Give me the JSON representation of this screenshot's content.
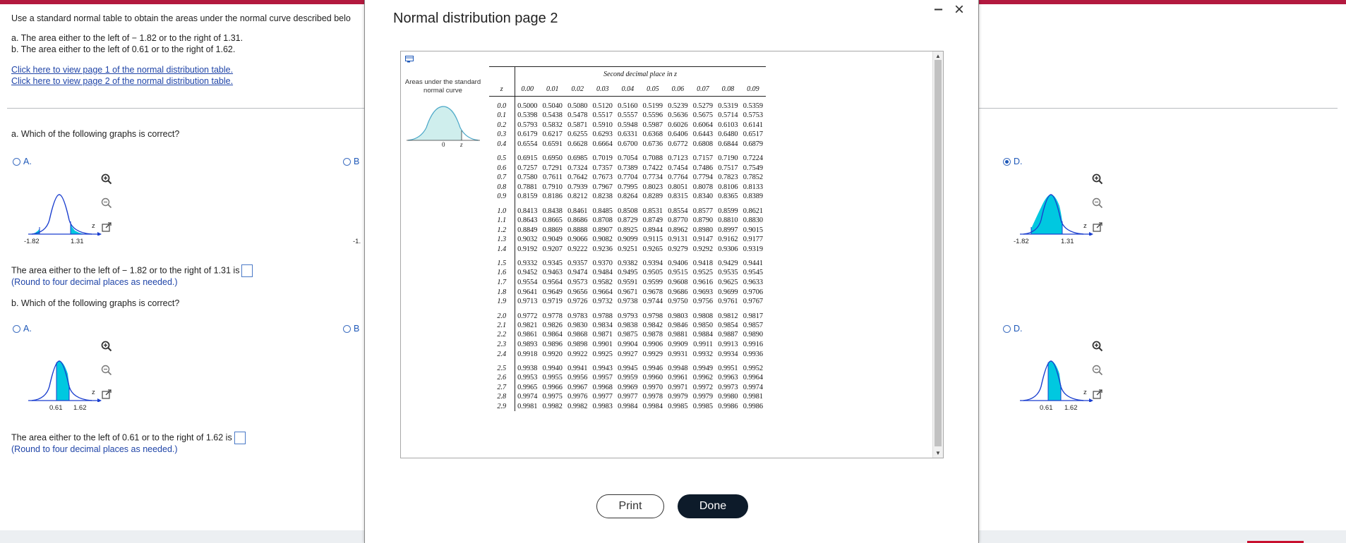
{
  "question": {
    "instruction": "Use a standard normal table to obtain the areas under the normal curve described belo",
    "part_a_text": "a. The area either to the left of  − 1.82 or to the right of 1.31.",
    "part_b_text": "b. The area either to the left of 0.61 or to the right of 1.62.",
    "link1": "Click here to view page 1 of the normal distribution table.",
    "link2": "Click here to view page 2 of the normal distribution table.",
    "a_prompt": "a. Which of the following graphs is correct?",
    "b_prompt": "b. Which of the following graphs is correct?",
    "a_answer": "The area either to the left of  − 1.82 or to the right of 1.31 is",
    "b_answer": "The area either to the left of 0.61 or to the right of 1.62 is",
    "round_note": "(Round to four decimal places as needed.)",
    "options": {
      "A": "A.",
      "B": "B",
      "D": "D."
    },
    "a_labels": {
      "left": "-1.82",
      "right": "1.31",
      "z": "z",
      "clip": "-1."
    },
    "b_labels": {
      "left": "0.61",
      "right": "1.62",
      "z": "z"
    }
  },
  "modal": {
    "title": "Normal distribution page 2",
    "curve_caption": "Areas under the standard normal curve",
    "curve_zero": "0",
    "curve_z": "z",
    "second_decimal_title": "Second decimal place in z",
    "z_header": "z",
    "print_label": "Print",
    "done_label": "Done"
  },
  "table": {
    "columns": [
      "0.00",
      "0.01",
      "0.02",
      "0.03",
      "0.04",
      "0.05",
      "0.06",
      "0.07",
      "0.08",
      "0.09"
    ],
    "rows": [
      [
        "0.0",
        "0.5000",
        "0.5040",
        "0.5080",
        "0.5120",
        "0.5160",
        "0.5199",
        "0.5239",
        "0.5279",
        "0.5319",
        "0.5359"
      ],
      [
        "0.1",
        "0.5398",
        "0.5438",
        "0.5478",
        "0.5517",
        "0.5557",
        "0.5596",
        "0.5636",
        "0.5675",
        "0.5714",
        "0.5753"
      ],
      [
        "0.2",
        "0.5793",
        "0.5832",
        "0.5871",
        "0.5910",
        "0.5948",
        "0.5987",
        "0.6026",
        "0.6064",
        "0.6103",
        "0.6141"
      ],
      [
        "0.3",
        "0.6179",
        "0.6217",
        "0.6255",
        "0.6293",
        "0.6331",
        "0.6368",
        "0.6406",
        "0.6443",
        "0.6480",
        "0.6517"
      ],
      [
        "0.4",
        "0.6554",
        "0.6591",
        "0.6628",
        "0.6664",
        "0.6700",
        "0.6736",
        "0.6772",
        "0.6808",
        "0.6844",
        "0.6879"
      ],
      [
        "0.5",
        "0.6915",
        "0.6950",
        "0.6985",
        "0.7019",
        "0.7054",
        "0.7088",
        "0.7123",
        "0.7157",
        "0.7190",
        "0.7224"
      ],
      [
        "0.6",
        "0.7257",
        "0.7291",
        "0.7324",
        "0.7357",
        "0.7389",
        "0.7422",
        "0.7454",
        "0.7486",
        "0.7517",
        "0.7549"
      ],
      [
        "0.7",
        "0.7580",
        "0.7611",
        "0.7642",
        "0.7673",
        "0.7704",
        "0.7734",
        "0.7764",
        "0.7794",
        "0.7823",
        "0.7852"
      ],
      [
        "0.8",
        "0.7881",
        "0.7910",
        "0.7939",
        "0.7967",
        "0.7995",
        "0.8023",
        "0.8051",
        "0.8078",
        "0.8106",
        "0.8133"
      ],
      [
        "0.9",
        "0.8159",
        "0.8186",
        "0.8212",
        "0.8238",
        "0.8264",
        "0.8289",
        "0.8315",
        "0.8340",
        "0.8365",
        "0.8389"
      ],
      [
        "1.0",
        "0.8413",
        "0.8438",
        "0.8461",
        "0.8485",
        "0.8508",
        "0.8531",
        "0.8554",
        "0.8577",
        "0.8599",
        "0.8621"
      ],
      [
        "1.1",
        "0.8643",
        "0.8665",
        "0.8686",
        "0.8708",
        "0.8729",
        "0.8749",
        "0.8770",
        "0.8790",
        "0.8810",
        "0.8830"
      ],
      [
        "1.2",
        "0.8849",
        "0.8869",
        "0.8888",
        "0.8907",
        "0.8925",
        "0.8944",
        "0.8962",
        "0.8980",
        "0.8997",
        "0.9015"
      ],
      [
        "1.3",
        "0.9032",
        "0.9049",
        "0.9066",
        "0.9082",
        "0.9099",
        "0.9115",
        "0.9131",
        "0.9147",
        "0.9162",
        "0.9177"
      ],
      [
        "1.4",
        "0.9192",
        "0.9207",
        "0.9222",
        "0.9236",
        "0.9251",
        "0.9265",
        "0.9279",
        "0.9292",
        "0.9306",
        "0.9319"
      ],
      [
        "1.5",
        "0.9332",
        "0.9345",
        "0.9357",
        "0.9370",
        "0.9382",
        "0.9394",
        "0.9406",
        "0.9418",
        "0.9429",
        "0.9441"
      ],
      [
        "1.6",
        "0.9452",
        "0.9463",
        "0.9474",
        "0.9484",
        "0.9495",
        "0.9505",
        "0.9515",
        "0.9525",
        "0.9535",
        "0.9545"
      ],
      [
        "1.7",
        "0.9554",
        "0.9564",
        "0.9573",
        "0.9582",
        "0.9591",
        "0.9599",
        "0.9608",
        "0.9616",
        "0.9625",
        "0.9633"
      ],
      [
        "1.8",
        "0.9641",
        "0.9649",
        "0.9656",
        "0.9664",
        "0.9671",
        "0.9678",
        "0.9686",
        "0.9693",
        "0.9699",
        "0.9706"
      ],
      [
        "1.9",
        "0.9713",
        "0.9719",
        "0.9726",
        "0.9732",
        "0.9738",
        "0.9744",
        "0.9750",
        "0.9756",
        "0.9761",
        "0.9767"
      ],
      [
        "2.0",
        "0.9772",
        "0.9778",
        "0.9783",
        "0.9788",
        "0.9793",
        "0.9798",
        "0.9803",
        "0.9808",
        "0.9812",
        "0.9817"
      ],
      [
        "2.1",
        "0.9821",
        "0.9826",
        "0.9830",
        "0.9834",
        "0.9838",
        "0.9842",
        "0.9846",
        "0.9850",
        "0.9854",
        "0.9857"
      ],
      [
        "2.2",
        "0.9861",
        "0.9864",
        "0.9868",
        "0.9871",
        "0.9875",
        "0.9878",
        "0.9881",
        "0.9884",
        "0.9887",
        "0.9890"
      ],
      [
        "2.3",
        "0.9893",
        "0.9896",
        "0.9898",
        "0.9901",
        "0.9904",
        "0.9906",
        "0.9909",
        "0.9911",
        "0.9913",
        "0.9916"
      ],
      [
        "2.4",
        "0.9918",
        "0.9920",
        "0.9922",
        "0.9925",
        "0.9927",
        "0.9929",
        "0.9931",
        "0.9932",
        "0.9934",
        "0.9936"
      ],
      [
        "2.5",
        "0.9938",
        "0.9940",
        "0.9941",
        "0.9943",
        "0.9945",
        "0.9946",
        "0.9948",
        "0.9949",
        "0.9951",
        "0.9952"
      ],
      [
        "2.6",
        "0.9953",
        "0.9955",
        "0.9956",
        "0.9957",
        "0.9959",
        "0.9960",
        "0.9961",
        "0.9962",
        "0.9963",
        "0.9964"
      ],
      [
        "2.7",
        "0.9965",
        "0.9966",
        "0.9967",
        "0.9968",
        "0.9969",
        "0.9970",
        "0.9971",
        "0.9972",
        "0.9973",
        "0.9974"
      ],
      [
        "2.8",
        "0.9974",
        "0.9975",
        "0.9976",
        "0.9977",
        "0.9977",
        "0.9978",
        "0.9979",
        "0.9979",
        "0.9980",
        "0.9981"
      ],
      [
        "2.9",
        "0.9981",
        "0.9982",
        "0.9982",
        "0.9983",
        "0.9984",
        "0.9984",
        "0.9985",
        "0.9985",
        "0.9986",
        "0.9986"
      ]
    ]
  },
  "colors": {
    "accent": "#b3193f",
    "link": "#2045a8",
    "fill": "#00c8e0",
    "done": "#0d1b2a"
  },
  "icons": [
    "zoom-in-icon",
    "zoom-out-icon",
    "external-link-icon",
    "table-icon",
    "minimize-icon",
    "close-icon"
  ]
}
